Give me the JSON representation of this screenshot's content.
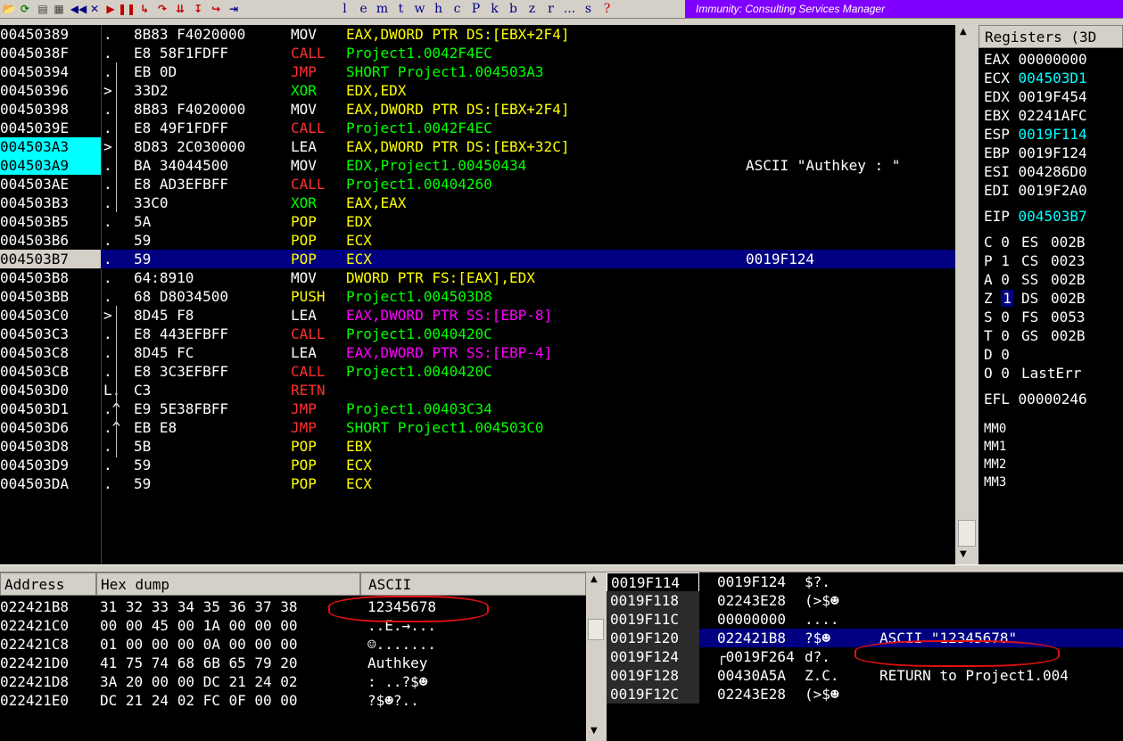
{
  "toolbar": {
    "buttons": [
      "open",
      "restart",
      "close",
      "run",
      "pause",
      "step-into",
      "step-over",
      "trace-into",
      "trace-over",
      "execute-till-return",
      "go-to"
    ],
    "letters": [
      "l",
      "e",
      "m",
      "t",
      "w",
      "h",
      "c",
      "P",
      "k",
      "b",
      "z",
      "r",
      "...",
      "s",
      "?"
    ],
    "title": "Immunity: Consulting Services Manager"
  },
  "colors": {
    "mnem_mov": "#ffffff",
    "mnem_call": "#ff3030",
    "mnem_jmp": "#ff3030",
    "mnem_push_pop": "#ffff00",
    "ops_default": "#00ff00",
    "ops_reg": "#ffff00",
    "ops_mem": "#ff00ff",
    "reg_changed": "#00ffff",
    "selection": "#000080"
  },
  "disasm": [
    {
      "addr": "00450389",
      "mark": ".",
      "hex": "8B83 F4020000",
      "mnem": "MOV",
      "ops": "EAX,DWORD PTR DS:[EBX+2F4]",
      "comment": "",
      "kind": "mov-mem"
    },
    {
      "addr": "0045038F",
      "mark": ".",
      "hex": "E8 58F1FDFF",
      "mnem": "CALL",
      "ops": "Project1.0042F4EC",
      "comment": "",
      "kind": "call"
    },
    {
      "addr": "00450394",
      "mark": ".",
      "hex": "EB 0D",
      "mnem": "JMP",
      "ops": "SHORT Project1.004503A3",
      "comment": "",
      "kind": "jmp"
    },
    {
      "addr": "00450396",
      "mark": ">",
      "hex": "33D2",
      "mnem": "XOR",
      "ops": "EDX,EDX",
      "comment": "",
      "kind": "xor"
    },
    {
      "addr": "00450398",
      "mark": ".",
      "hex": "8B83 F4020000",
      "mnem": "MOV",
      "ops": "EAX,DWORD PTR DS:[EBX+2F4]",
      "comment": "",
      "kind": "mov-mem"
    },
    {
      "addr": "0045039E",
      "mark": ".",
      "hex": "E8 49F1FDFF",
      "mnem": "CALL",
      "ops": "Project1.0042F4EC",
      "comment": "",
      "kind": "call"
    },
    {
      "addr": "004503A3",
      "mark": ">",
      "hex": "8D83 2C030000",
      "mnem": "LEA",
      "ops": "EAX,DWORD PTR DS:[EBX+32C]",
      "comment": "",
      "kind": "mov-mem",
      "hl": true
    },
    {
      "addr": "004503A9",
      "mark": ".",
      "hex": "BA 34044500",
      "mnem": "MOV",
      "ops": "EDX,Project1.00450434",
      "comment": "ASCII \"Authkey : \"",
      "kind": "mov",
      "hl": true
    },
    {
      "addr": "004503AE",
      "mark": ".",
      "hex": "E8 AD3EFBFF",
      "mnem": "CALL",
      "ops": "Project1.00404260",
      "comment": "",
      "kind": "call"
    },
    {
      "addr": "004503B3",
      "mark": ".",
      "hex": "33C0",
      "mnem": "XOR",
      "ops": "EAX,EAX",
      "comment": "",
      "kind": "xor"
    },
    {
      "addr": "004503B5",
      "mark": ".",
      "hex": "5A",
      "mnem": "POP",
      "ops": "EDX",
      "comment": "",
      "kind": "pop"
    },
    {
      "addr": "004503B6",
      "mark": ".",
      "hex": "59",
      "mnem": "POP",
      "ops": "ECX",
      "comment": "",
      "kind": "pop"
    },
    {
      "addr": "004503B7",
      "mark": ".",
      "hex": "59",
      "mnem": "POP",
      "ops": "ECX",
      "comment": "0019F124",
      "kind": "pop",
      "sel": true
    },
    {
      "addr": "004503B8",
      "mark": ".",
      "hex": "64:8910",
      "mnem": "MOV",
      "ops": "DWORD PTR FS:[EAX],EDX",
      "comment": "",
      "kind": "mov-fs"
    },
    {
      "addr": "004503BB",
      "mark": ".",
      "hex": "68 D8034500",
      "mnem": "PUSH",
      "ops": "Project1.004503D8",
      "comment": "",
      "kind": "push"
    },
    {
      "addr": "004503C0",
      "mark": ">",
      "hex": "8D45 F8",
      "mnem": "LEA",
      "ops": "EAX,DWORD PTR SS:[EBP-8]",
      "comment": "",
      "kind": "lea-ss"
    },
    {
      "addr": "004503C3",
      "mark": ".",
      "hex": "E8 443EFBFF",
      "mnem": "CALL",
      "ops": "Project1.0040420C",
      "comment": "",
      "kind": "call"
    },
    {
      "addr": "004503C8",
      "mark": ".",
      "hex": "8D45 FC",
      "mnem": "LEA",
      "ops": "EAX,DWORD PTR SS:[EBP-4]",
      "comment": "",
      "kind": "lea-ss"
    },
    {
      "addr": "004503CB",
      "mark": ".",
      "hex": "E8 3C3EFBFF",
      "mnem": "CALL",
      "ops": "Project1.0040420C",
      "comment": "",
      "kind": "call"
    },
    {
      "addr": "004503D0",
      "mark": "L.",
      "hex": "C3",
      "mnem": "RETN",
      "ops": "",
      "comment": "",
      "kind": "ret"
    },
    {
      "addr": "004503D1",
      "mark": ".^",
      "hex": "E9 5E38FBFF",
      "mnem": "JMP",
      "ops": "Project1.00403C34",
      "comment": "",
      "kind": "jmp"
    },
    {
      "addr": "004503D6",
      "mark": ".^",
      "hex": "EB E8",
      "mnem": "JMP",
      "ops": "SHORT Project1.004503C0",
      "comment": "",
      "kind": "jmp"
    },
    {
      "addr": "004503D8",
      "mark": ".",
      "hex": "5B",
      "mnem": "POP",
      "ops": "EBX",
      "comment": "",
      "kind": "pop"
    },
    {
      "addr": "004503D9",
      "mark": ".",
      "hex": "59",
      "mnem": "POP",
      "ops": "ECX",
      "comment": "",
      "kind": "pop"
    },
    {
      "addr": "004503DA",
      "mark": ".",
      "hex": "59",
      "mnem": "POP",
      "ops": "ECX",
      "comment": "",
      "kind": "pop"
    }
  ],
  "registers": {
    "title": "Registers (3D",
    "general": [
      {
        "name": "EAX",
        "value": "00000000",
        "changed": false
      },
      {
        "name": "ECX",
        "value": "004503D1",
        "changed": true
      },
      {
        "name": "EDX",
        "value": "0019F454",
        "changed": false
      },
      {
        "name": "EBX",
        "value": "02241AFC",
        "changed": false
      },
      {
        "name": "ESP",
        "value": "0019F114",
        "changed": true
      },
      {
        "name": "EBP",
        "value": "0019F124",
        "changed": false
      },
      {
        "name": "ESI",
        "value": "004286D0",
        "changed": false
      },
      {
        "name": "EDI",
        "value": "0019F2A0",
        "changed": false
      }
    ],
    "eip": {
      "name": "EIP",
      "value": "004503B7",
      "changed": true
    },
    "flags": [
      {
        "flag": "C",
        "bit": "0",
        "seg": "ES",
        "val": "002B"
      },
      {
        "flag": "P",
        "bit": "1",
        "seg": "CS",
        "val": "0023"
      },
      {
        "flag": "A",
        "bit": "0",
        "seg": "SS",
        "val": "002B"
      },
      {
        "flag": "Z",
        "bit": "1",
        "seg": "DS",
        "val": "002B",
        "bitsel": true
      },
      {
        "flag": "S",
        "bit": "0",
        "seg": "FS",
        "val": "0053"
      },
      {
        "flag": "T",
        "bit": "0",
        "seg": "GS",
        "val": "002B"
      },
      {
        "flag": "D",
        "bit": "0",
        "seg": "",
        "val": ""
      },
      {
        "flag": "O",
        "bit": "0",
        "seg": "LastErr",
        "val": ""
      }
    ],
    "efl": {
      "name": "EFL",
      "value": "00000246"
    },
    "mm": [
      "MM0",
      "MM1",
      "MM2",
      "MM3"
    ]
  },
  "dump": {
    "headers": {
      "address": "Address",
      "hex": "Hex dump",
      "ascii": "ASCII"
    },
    "rows": [
      {
        "addr": "022421B8",
        "hex": "31 32 33 34 35 36 37 38",
        "ascii": "12345678"
      },
      {
        "addr": "022421C0",
        "hex": "00 00 45 00 1A 00 00 00",
        "ascii": "..E.→..."
      },
      {
        "addr": "022421C8",
        "hex": "01 00 00 00 0A 00 00 00",
        "ascii": "☺......."
      },
      {
        "addr": "022421D0",
        "hex": "41 75 74 68 6B 65 79 20",
        "ascii": "Authkey"
      },
      {
        "addr": "022421D8",
        "hex": "3A 20 00 00 DC 21 24 02",
        "ascii": ": ..?$☻"
      },
      {
        "addr": "022421E0",
        "hex": "DC 21 24 02 FC 0F 00 00",
        "ascii": "?$☻?.."
      }
    ]
  },
  "stack": [
    {
      "addr": "0019F114",
      "value": "0019F124",
      "ascii": "$?.",
      "comment": ""
    },
    {
      "addr": "0019F118",
      "value": "02243E28",
      "ascii": "(>$☻",
      "comment": ""
    },
    {
      "addr": "0019F11C",
      "value": "00000000",
      "ascii": "....",
      "comment": ""
    },
    {
      "addr": "0019F120",
      "value": "022421B8",
      "ascii": "?$☻",
      "comment": "ASCII \"12345678\"",
      "sel": true
    },
    {
      "addr": "0019F124",
      "value": "┌0019F264",
      "ascii": "d?.",
      "comment": ""
    },
    {
      "addr": "0019F128",
      "value": "00430A5A",
      "ascii": "Z.C.",
      "comment": "RETURN to Project1.004"
    },
    {
      "addr": "0019F12C",
      "value": "02243E28",
      "ascii": "(>$☻",
      "comment": ""
    }
  ]
}
